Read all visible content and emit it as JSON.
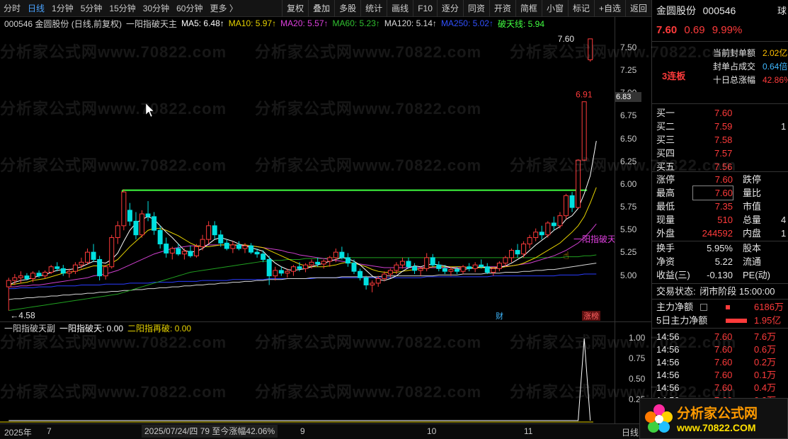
{
  "toolbar": {
    "periods": [
      "分时",
      "日线",
      "1分钟",
      "5分钟",
      "15分钟",
      "30分钟",
      "60分钟",
      "更多 〉"
    ],
    "active_period": "日线",
    "tools": [
      "复权",
      "叠加",
      "多股",
      "统计",
      "画线",
      "F10",
      "逐分",
      "同资",
      "开资",
      "简框",
      "小窗",
      "标记",
      "+自选",
      "返回"
    ]
  },
  "legend": {
    "stock": "000546 金圆股份 (日线,前复权)",
    "indicator": "一阳指破天主",
    "ma5": "MA5: 6.48↑",
    "ma10": "MA10: 5.97↑",
    "ma20": "MA20: 5.57↑",
    "ma60": "MA60: 5.23↑",
    "ma120": "MA120: 5.14↑",
    "ma250": "MA250: 5.02↑",
    "potian": "破天线: 5.94"
  },
  "colors": {
    "up": "#ff3b3b",
    "down": "#00e0e0",
    "ma5": "#ffffff",
    "ma10": "#e6d200",
    "ma20": "#d040d0",
    "ma60": "#20a020",
    "ma120": "#d8d8d8",
    "ma250": "#2a3cff",
    "potian": "#40ff40"
  },
  "y_axis": {
    "main": [
      "7.50",
      "7.25",
      "7.00",
      "6.75",
      "6.50",
      "6.25",
      "6.00",
      "5.75",
      "5.50",
      "5.25",
      "5.00"
    ],
    "sub": [
      "1.00",
      "0.75",
      "0.50",
      "0.25"
    ]
  },
  "chart_data": {
    "type": "candlestick",
    "ylim": [
      4.5,
      7.7
    ],
    "last_price_label": "7.60",
    "high_label": "6.91",
    "low_label": "←4.58",
    "cursor_price": "6.83",
    "signal_label": "一阳指破天",
    "badges": [
      "财",
      "涨榜"
    ],
    "potian_level": 5.94,
    "candles": [
      [
        4.88,
        4.98,
        4.62,
        4.95
      ],
      [
        4.95,
        5.02,
        4.9,
        4.98
      ],
      [
        4.98,
        5.05,
        4.92,
        5.0
      ],
      [
        5.0,
        5.03,
        4.95,
        4.97
      ],
      [
        4.97,
        5.05,
        4.93,
        5.03
      ],
      [
        5.03,
        5.06,
        4.98,
        5.0
      ],
      [
        5.0,
        5.06,
        4.97,
        5.04
      ],
      [
        5.04,
        5.12,
        5.02,
        5.1
      ],
      [
        5.1,
        5.15,
        5.05,
        5.08
      ],
      [
        5.08,
        5.12,
        5.0,
        5.03
      ],
      [
        5.03,
        5.08,
        4.98,
        5.05
      ],
      [
        5.05,
        5.15,
        5.02,
        5.12
      ],
      [
        5.12,
        5.2,
        5.08,
        5.15
      ],
      [
        5.15,
        5.3,
        5.12,
        5.26
      ],
      [
        5.26,
        5.35,
        5.15,
        5.18
      ],
      [
        5.18,
        5.22,
        4.95,
        5.0
      ],
      [
        5.0,
        5.12,
        4.96,
        5.1
      ],
      [
        5.1,
        5.45,
        5.08,
        5.42
      ],
      [
        5.42,
        5.6,
        5.35,
        5.55
      ],
      [
        5.55,
        5.95,
        5.5,
        5.92
      ],
      [
        5.72,
        5.8,
        5.55,
        5.6
      ],
      [
        5.6,
        5.7,
        5.4,
        5.45
      ],
      [
        5.45,
        5.72,
        5.42,
        5.68
      ],
      [
        5.68,
        5.82,
        5.6,
        5.65
      ],
      [
        5.65,
        5.7,
        5.45,
        5.5
      ],
      [
        5.5,
        5.55,
        5.3,
        5.35
      ],
      [
        5.35,
        5.42,
        5.2,
        5.25
      ],
      [
        5.25,
        5.32,
        5.18,
        5.3
      ],
      [
        5.3,
        5.35,
        5.22,
        5.24
      ],
      [
        5.24,
        5.3,
        5.18,
        5.27
      ],
      [
        5.27,
        5.33,
        5.2,
        5.22
      ],
      [
        5.22,
        5.35,
        5.2,
        5.32
      ],
      [
        5.32,
        5.45,
        5.28,
        5.4
      ],
      [
        5.4,
        5.6,
        5.35,
        5.55
      ],
      [
        5.55,
        5.6,
        5.4,
        5.45
      ],
      [
        5.45,
        5.5,
        5.32,
        5.36
      ],
      [
        5.36,
        5.4,
        5.28,
        5.3
      ],
      [
        5.3,
        5.38,
        5.25,
        5.34
      ],
      [
        5.34,
        5.38,
        5.28,
        5.3
      ],
      [
        5.3,
        5.36,
        5.25,
        5.33
      ],
      [
        5.33,
        5.36,
        5.24,
        5.26
      ],
      [
        5.26,
        5.3,
        5.2,
        5.24
      ],
      [
        5.24,
        5.28,
        5.15,
        5.18
      ],
      [
        5.18,
        5.22,
        4.9,
        5.0
      ],
      [
        5.0,
        5.1,
        4.95,
        5.06
      ],
      [
        5.06,
        5.1,
        5.0,
        5.03
      ],
      [
        5.03,
        5.08,
        4.98,
        5.05
      ],
      [
        5.05,
        5.12,
        5.0,
        5.1
      ],
      [
        5.1,
        5.15,
        5.05,
        5.08
      ],
      [
        5.08,
        5.14,
        5.04,
        5.12
      ],
      [
        5.12,
        5.18,
        5.08,
        5.15
      ],
      [
        5.15,
        5.2,
        5.1,
        5.13
      ],
      [
        5.13,
        5.18,
        5.08,
        5.16
      ],
      [
        5.16,
        5.22,
        5.1,
        5.2
      ],
      [
        5.2,
        5.3,
        5.15,
        5.26
      ],
      [
        5.26,
        5.32,
        5.18,
        5.2
      ],
      [
        5.2,
        5.25,
        5.1,
        5.14
      ],
      [
        5.14,
        5.18,
        5.02,
        5.05
      ],
      [
        5.05,
        5.08,
        4.95,
        4.98
      ],
      [
        4.98,
        5.0,
        4.85,
        4.9
      ],
      [
        4.9,
        4.95,
        4.82,
        4.92
      ],
      [
        4.92,
        5.0,
        4.88,
        4.97
      ],
      [
        4.97,
        5.05,
        4.94,
        5.02
      ],
      [
        5.02,
        5.08,
        4.98,
        5.06
      ],
      [
        5.06,
        5.15,
        5.02,
        5.12
      ],
      [
        5.12,
        5.2,
        5.08,
        5.16
      ],
      [
        5.16,
        5.2,
        5.08,
        5.1
      ],
      [
        5.1,
        5.14,
        5.02,
        5.06
      ],
      [
        5.06,
        5.1,
        5.0,
        5.08
      ],
      [
        5.08,
        5.25,
        5.05,
        5.2
      ],
      [
        5.2,
        5.24,
        5.1,
        5.12
      ],
      [
        5.12,
        5.16,
        5.05,
        5.08
      ],
      [
        5.08,
        5.12,
        5.02,
        5.05
      ],
      [
        5.05,
        5.1,
        5.0,
        5.07
      ],
      [
        5.07,
        5.1,
        5.02,
        5.05
      ],
      [
        5.05,
        5.12,
        5.02,
        5.1
      ],
      [
        5.1,
        5.14,
        5.05,
        5.08
      ],
      [
        5.08,
        5.15,
        5.04,
        5.12
      ],
      [
        5.12,
        5.18,
        5.08,
        5.1
      ],
      [
        5.1,
        5.14,
        5.02,
        5.04
      ],
      [
        5.04,
        5.1,
        5.0,
        5.08
      ],
      [
        5.08,
        5.16,
        5.05,
        5.14
      ],
      [
        5.14,
        5.22,
        5.1,
        5.2
      ],
      [
        5.2,
        5.3,
        5.15,
        5.28
      ],
      [
        5.28,
        5.35,
        5.2,
        5.24
      ],
      [
        5.24,
        5.38,
        5.2,
        5.35
      ],
      [
        5.35,
        5.45,
        5.3,
        5.42
      ],
      [
        5.42,
        5.52,
        5.38,
        5.48
      ],
      [
        5.48,
        5.55,
        5.4,
        5.45
      ],
      [
        5.45,
        5.6,
        5.42,
        5.58
      ],
      [
        5.58,
        5.65,
        5.5,
        5.55
      ],
      [
        5.55,
        5.7,
        5.52,
        5.66
      ],
      [
        5.66,
        5.9,
        5.62,
        5.88
      ],
      [
        5.88,
        5.92,
        5.7,
        5.75
      ],
      [
        5.75,
        6.28,
        5.74,
        6.27
      ],
      [
        6.27,
        6.91,
        6.26,
        6.91
      ],
      [
        7.37,
        7.6,
        7.35,
        7.6
      ]
    ],
    "ma5": [
      4.9,
      4.93,
      4.95,
      4.96,
      4.98,
      5.0,
      5.01,
      5.04,
      5.06,
      5.07,
      5.07,
      5.08,
      5.1,
      5.13,
      5.16,
      5.15,
      5.14,
      5.18,
      5.25,
      5.38,
      5.5,
      5.58,
      5.62,
      5.65,
      5.62,
      5.55,
      5.48,
      5.42,
      5.35,
      5.28,
      5.26,
      5.27,
      5.3,
      5.35,
      5.4,
      5.42,
      5.4,
      5.38,
      5.35,
      5.33,
      5.31,
      5.29,
      5.27,
      5.2,
      5.14,
      5.1,
      5.07,
      5.06,
      5.07,
      5.08,
      5.1,
      5.12,
      5.14,
      5.16,
      5.18,
      5.2,
      5.19,
      5.16,
      5.12,
      5.06,
      5.0,
      4.96,
      4.95,
      4.97,
      5.0,
      5.05,
      5.09,
      5.11,
      5.1,
      5.12,
      5.13,
      5.12,
      5.11,
      5.09,
      5.08,
      5.07,
      5.08,
      5.09,
      5.1,
      5.09,
      5.08,
      5.09,
      5.11,
      5.14,
      5.18,
      5.22,
      5.28,
      5.34,
      5.39,
      5.44,
      5.5,
      5.54,
      5.62,
      5.66,
      5.74,
      5.9,
      6.1,
      6.48
    ],
    "ma10": [
      4.9,
      4.91,
      4.92,
      4.93,
      4.95,
      4.96,
      4.97,
      4.99,
      5.01,
      5.03,
      5.04,
      5.05,
      5.07,
      5.09,
      5.11,
      5.11,
      5.11,
      5.14,
      5.18,
      5.25,
      5.32,
      5.38,
      5.44,
      5.5,
      5.52,
      5.52,
      5.5,
      5.47,
      5.44,
      5.4,
      5.36,
      5.33,
      5.32,
      5.32,
      5.33,
      5.34,
      5.34,
      5.34,
      5.34,
      5.34,
      5.33,
      5.32,
      5.31,
      5.28,
      5.25,
      5.22,
      5.19,
      5.16,
      5.13,
      5.11,
      5.1,
      5.1,
      5.1,
      5.11,
      5.12,
      5.14,
      5.15,
      5.14,
      5.12,
      5.1,
      5.07,
      5.05,
      5.04,
      5.04,
      5.04,
      5.05,
      5.06,
      5.07,
      5.08,
      5.09,
      5.1,
      5.1,
      5.1,
      5.1,
      5.1,
      5.1,
      5.09,
      5.09,
      5.09,
      5.09,
      5.09,
      5.09,
      5.1,
      5.11,
      5.12,
      5.14,
      5.17,
      5.2,
      5.24,
      5.28,
      5.32,
      5.36,
      5.42,
      5.48,
      5.55,
      5.65,
      5.8,
      5.97
    ],
    "ma20": [
      4.88,
      4.88,
      4.89,
      4.89,
      4.9,
      4.9,
      4.91,
      4.92,
      4.93,
      4.94,
      4.95,
      4.96,
      4.97,
      4.98,
      5.0,
      5.01,
      5.02,
      5.04,
      5.06,
      5.09,
      5.12,
      5.15,
      5.18,
      5.21,
      5.24,
      5.26,
      5.28,
      5.3,
      5.31,
      5.32,
      5.33,
      5.33,
      5.33,
      5.34,
      5.34,
      5.34,
      5.34,
      5.34,
      5.33,
      5.33,
      5.33,
      5.32,
      5.31,
      5.3,
      5.29,
      5.28,
      5.26,
      5.25,
      5.23,
      5.22,
      5.21,
      5.2,
      5.19,
      5.18,
      5.17,
      5.16,
      5.15,
      5.14,
      5.13,
      5.12,
      5.11,
      5.1,
      5.09,
      5.09,
      5.09,
      5.09,
      5.09,
      5.09,
      5.09,
      5.09,
      5.09,
      5.09,
      5.09,
      5.09,
      5.09,
      5.09,
      5.09,
      5.09,
      5.1,
      5.1,
      5.1,
      5.1,
      5.11,
      5.11,
      5.12,
      5.13,
      5.14,
      5.16,
      5.18,
      5.2,
      5.22,
      5.25,
      5.28,
      5.32,
      5.36,
      5.42,
      5.49,
      5.57
    ],
    "ma60": [
      4.62,
      4.63,
      4.64,
      4.65,
      4.66,
      4.67,
      4.68,
      4.69,
      4.7,
      4.71,
      4.72,
      4.73,
      4.74,
      4.75,
      4.76,
      4.77,
      4.78,
      4.79,
      4.8,
      4.82,
      4.84,
      4.86,
      4.88,
      4.9,
      4.92,
      4.94,
      4.96,
      4.98,
      5.0,
      5.02,
      5.04,
      5.05,
      5.06,
      5.07,
      5.08,
      5.09,
      5.1,
      5.11,
      5.12,
      5.13,
      5.14,
      5.15,
      5.16,
      5.16,
      5.17,
      5.17,
      5.18,
      5.18,
      5.18,
      5.19,
      5.19,
      5.19,
      5.19,
      5.2,
      5.2,
      5.2,
      5.2,
      5.2,
      5.2,
      5.2,
      5.2,
      5.2,
      5.2,
      5.2,
      5.2,
      5.2,
      5.2,
      5.2,
      5.2,
      5.2,
      5.2,
      5.2,
      5.2,
      5.2,
      5.2,
      5.2,
      5.2,
      5.2,
      5.2,
      5.2,
      5.2,
      5.2,
      5.2,
      5.2,
      5.2,
      5.2,
      5.2,
      5.2,
      5.2,
      5.2,
      5.2,
      5.2,
      5.21,
      5.21,
      5.21,
      5.22,
      5.22,
      5.23
    ],
    "ma120": [
      4.74,
      4.75,
      4.75,
      4.76,
      4.76,
      4.77,
      4.77,
      4.78,
      4.78,
      4.79,
      4.79,
      4.8,
      4.8,
      4.81,
      4.81,
      4.82,
      4.82,
      4.83,
      4.83,
      4.84,
      4.84,
      4.85,
      4.85,
      4.86,
      4.86,
      4.87,
      4.87,
      4.88,
      4.88,
      4.89,
      4.89,
      4.9,
      4.9,
      4.91,
      4.91,
      4.92,
      4.92,
      4.93,
      4.93,
      4.94,
      4.94,
      4.95,
      4.95,
      4.96,
      4.96,
      4.96,
      4.97,
      4.97,
      4.97,
      4.97,
      4.98,
      4.98,
      4.98,
      4.98,
      4.98,
      4.99,
      4.99,
      4.99,
      4.99,
      4.99,
      4.99,
      4.99,
      5.0,
      5.0,
      5.0,
      5.0,
      5.0,
      5.0,
      5.0,
      5.0,
      5.0,
      5.01,
      5.01,
      5.01,
      5.01,
      5.02,
      5.02,
      5.02,
      5.02,
      5.03,
      5.03,
      5.03,
      5.04,
      5.04,
      5.04,
      5.05,
      5.05,
      5.06,
      5.06,
      5.07,
      5.07,
      5.08,
      5.09,
      5.1,
      5.11,
      5.12,
      5.13,
      5.14
    ],
    "ma250": [
      4.86,
      4.86,
      4.87,
      4.87,
      4.87,
      4.88,
      4.88,
      4.88,
      4.89,
      4.89,
      4.89,
      4.89,
      4.9,
      4.9,
      4.9,
      4.9,
      4.91,
      4.91,
      4.91,
      4.91,
      4.92,
      4.92,
      4.92,
      4.92,
      4.93,
      4.93,
      4.93,
      4.93,
      4.94,
      4.94,
      4.94,
      4.94,
      4.95,
      4.95,
      4.95,
      4.95,
      4.95,
      4.96,
      4.96,
      4.96,
      4.96,
      4.96,
      4.96,
      4.97,
      4.97,
      4.97,
      4.97,
      4.97,
      4.97,
      4.97,
      4.97,
      4.98,
      4.98,
      4.98,
      4.98,
      4.98,
      4.98,
      4.98,
      4.98,
      4.98,
      4.98,
      4.98,
      4.98,
      4.98,
      4.98,
      4.98,
      4.98,
      4.98,
      4.98,
      4.99,
      4.99,
      4.99,
      4.99,
      4.99,
      4.99,
      4.99,
      4.99,
      4.99,
      4.99,
      4.99,
      5.0,
      5.0,
      5.0,
      5.0,
      5.0,
      5.0,
      5.0,
      5.0,
      5.0,
      5.0,
      5.0,
      5.01,
      5.01,
      5.01,
      5.01,
      5.02,
      5.02,
      5.02
    ],
    "sub_signal_index": 95
  },
  "sub_legend": {
    "name": "一阳指破天副",
    "line1": "一阳指破天: 0.00",
    "line2": "二阳指再破: 0.00"
  },
  "xaxis": {
    "labels": [
      "2025年",
      "7",
      "9",
      "10",
      "11"
    ],
    "info": "2025/07/24/四  79  至今涨幅42.06%",
    "period": "日线"
  },
  "rpanel": {
    "name": "金圆股份",
    "code": "000546",
    "price": "7.60",
    "change": "0.69",
    "pct": "9.99%",
    "lianban": "3连板",
    "seal_label": "当前封单额",
    "seal_value": "2.02亿",
    "seal_ratio_label": "封单占成交",
    "seal_ratio_value": "0.64倍",
    "ten_day_label": "十日总涨幅",
    "ten_day_value": "42.86%",
    "bids": [
      {
        "label": "买一",
        "price": "7.60",
        "vol": ""
      },
      {
        "label": "买二",
        "price": "7.59",
        "vol": "1"
      },
      {
        "label": "买三",
        "price": "7.58",
        "vol": ""
      },
      {
        "label": "买四",
        "price": "7.57",
        "vol": ""
      },
      {
        "label": "买五",
        "price": "7.56",
        "vol": ""
      }
    ],
    "stats": [
      {
        "l1": "涨停",
        "v1": "7.60",
        "l2": "跌停",
        "v2": ""
      },
      {
        "l1": "最高",
        "v1": "7.60",
        "l2": "量比",
        "v2": ""
      },
      {
        "l1": "最低",
        "v1": "7.35",
        "l2": "市值",
        "v2": ""
      },
      {
        "l1": "现量",
        "v1": "510",
        "l2": "总量",
        "v2": "4"
      },
      {
        "l1": "外盘",
        "v1": "244592",
        "l2": "内盘",
        "v2": "1"
      }
    ],
    "fin": [
      {
        "l1": "换手",
        "v1": "5.95%",
        "l2": "股本",
        "v2": ""
      },
      {
        "l1": "净资",
        "v1": "5.22",
        "l2": "流通",
        "v2": ""
      },
      {
        "l1": "收益(三)",
        "v1": "-0.130",
        "l2": "PE(动)",
        "v2": ""
      }
    ],
    "trade_state_label": "交易状态:",
    "trade_state": "闭市阶段 15:00:00",
    "main_flow_label": "主力净额",
    "main_flow_value": "6186万",
    "main_flow5_label": "5日主力净额",
    "main_flow5_value": "1.95亿",
    "ticks": [
      {
        "time": "14:56",
        "price": "7.60",
        "vol": "7.6万"
      },
      {
        "time": "14:56",
        "price": "7.60",
        "vol": "0.6万"
      },
      {
        "time": "14:56",
        "price": "7.60",
        "vol": "0.2万"
      },
      {
        "time": "14:56",
        "price": "7.60",
        "vol": "0.1万"
      },
      {
        "time": "14:56",
        "price": "7.60",
        "vol": "0.4万"
      },
      {
        "time": "14:56",
        "price": "7.60",
        "vol": "0.2万"
      }
    ],
    "side_tab": "球"
  },
  "watermark": "分析家公式网www.70822.com",
  "logo": {
    "title": "分析家公式网",
    "url": "www.70822.COM"
  }
}
